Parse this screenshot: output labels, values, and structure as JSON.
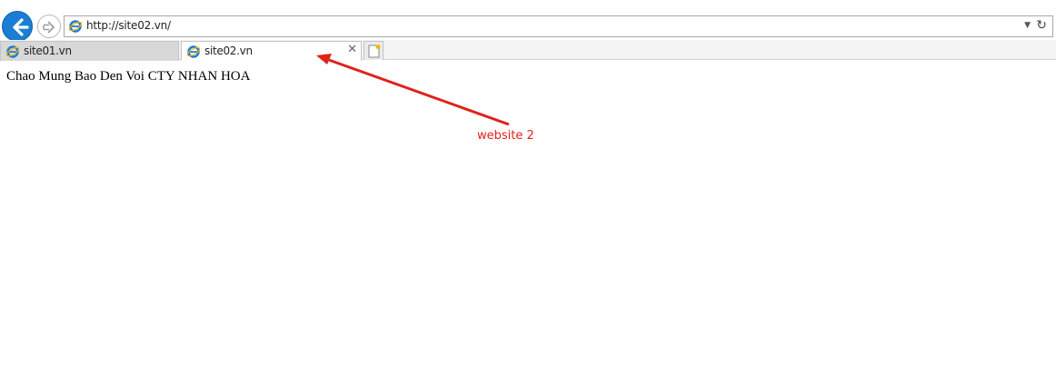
{
  "navbar": {
    "address": "http://site02.vn/"
  },
  "tabs": [
    {
      "label": "site01.vn",
      "active": false
    },
    {
      "label": "site02.vn",
      "active": true
    }
  ],
  "page": {
    "body_text": "Chao Mung Bao Den Voi CTY NHAN HOA"
  },
  "annotation": {
    "label": "website 2",
    "color": "#e0221b"
  },
  "colors": {
    "back_button": "#1a7fd4"
  }
}
